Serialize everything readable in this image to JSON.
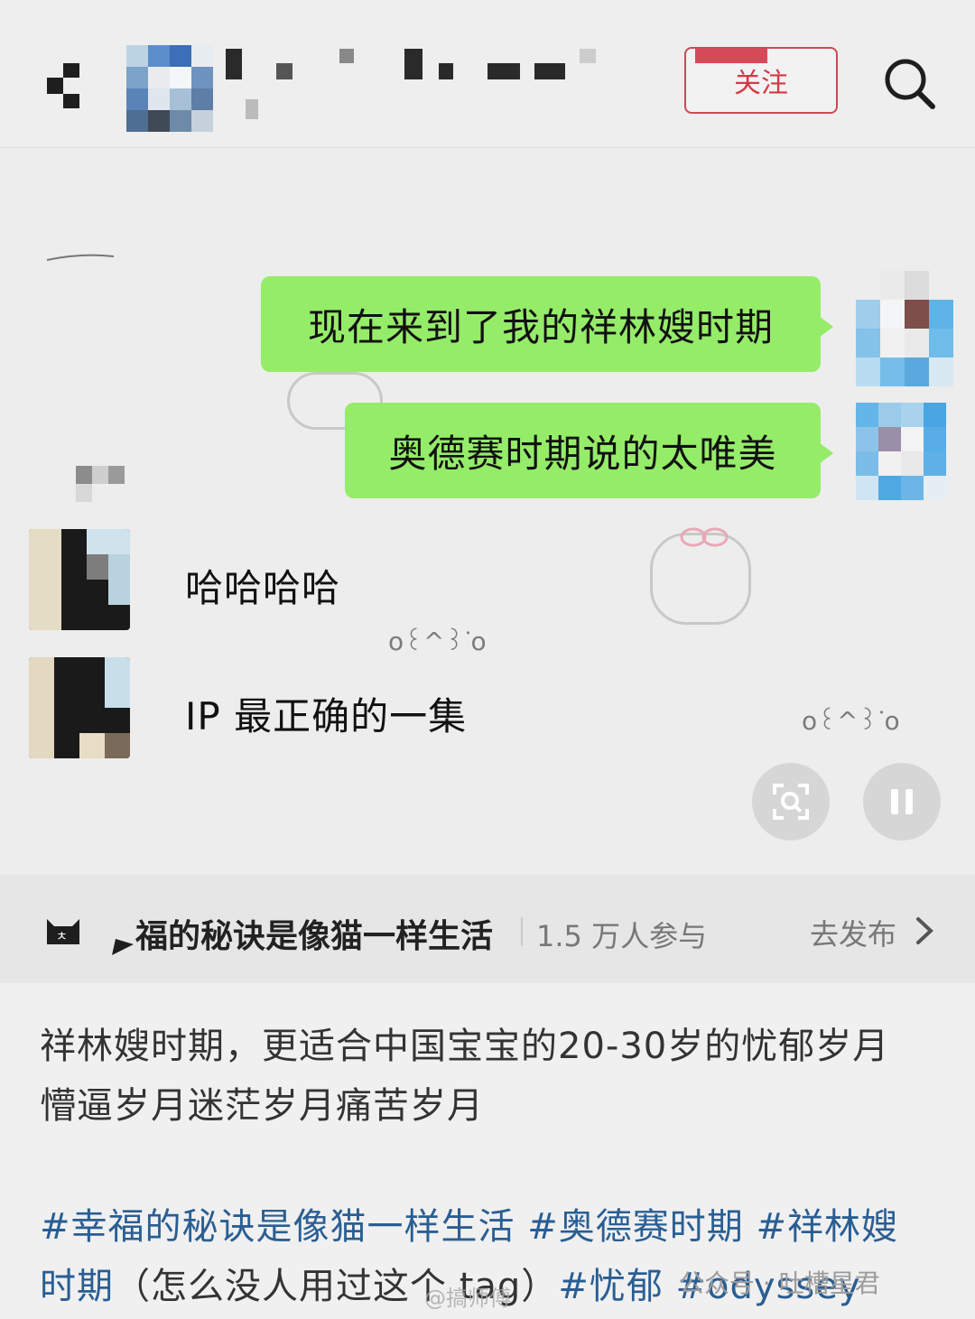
{
  "header": {
    "follow_label": "关注"
  },
  "chat": {
    "outgoing": [
      {
        "text": "现在来到了我的祥林嫂时期"
      },
      {
        "text": "奥德赛时期说的太唯美"
      }
    ],
    "incoming": [
      {
        "text": "哈哈哈哈"
      },
      {
        "text": "IP 最正确的一集"
      }
    ],
    "decorations": [
      "ο꒰^꒱ᐝο"
    ]
  },
  "topic": {
    "name": "福的秘诀是像猫一样生活",
    "participants": "1.5 万人参与",
    "publish_label": "去发布"
  },
  "post": {
    "body_line1": "祥林嫂时期，更适合中国宝宝的20-30岁的忧郁岁月",
    "body_line2": "懵逼岁月迷茫岁月痛苦岁月",
    "tags_line1": "#幸福的秘诀是像猫一样生活 #奥德赛时期 #祥林嫂",
    "tags_line2_a": "时期",
    "tags_line2_plain": "（怎么没人用过这个 tag）",
    "tags_line2_b": "#忧郁 #odyssey"
  },
  "watermarks": {
    "right": "公众号 · 吐槽星君",
    "center": "@搞师傅"
  },
  "colors": {
    "bubble_green": "#95ec69",
    "follow_red": "#d33a46",
    "tag_blue": "#2a5e93"
  },
  "icons": [
    "back-icon",
    "search-icon",
    "scan-icon",
    "pause-icon",
    "cat-topic-icon",
    "chevron-right-icon"
  ]
}
